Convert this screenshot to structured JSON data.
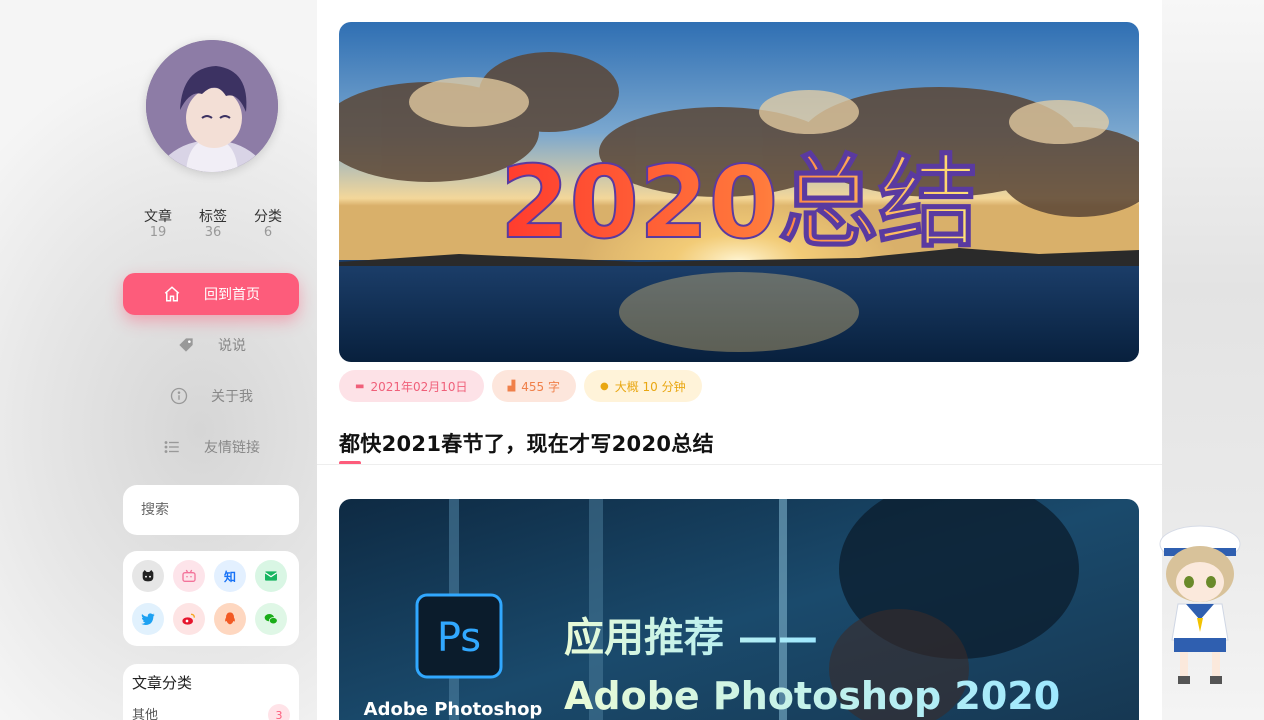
{
  "profile": {
    "stats": [
      {
        "label": "文章",
        "value": "19"
      },
      {
        "label": "标签",
        "value": "36"
      },
      {
        "label": "分类",
        "value": "6"
      }
    ]
  },
  "nav": [
    {
      "label": "回到首页",
      "icon": "home-icon",
      "active": true
    },
    {
      "label": "说说",
      "icon": "tag-icon",
      "active": false
    },
    {
      "label": "关于我",
      "icon": "info-icon",
      "active": false
    },
    {
      "label": "友情链接",
      "icon": "list-icon",
      "active": false
    }
  ],
  "search": {
    "placeholder": "搜索"
  },
  "social": [
    {
      "name": "github-icon",
      "glyph": "",
      "bg": "#e6e6e6",
      "color": "#222"
    },
    {
      "name": "bilibili-icon",
      "glyph": "",
      "bg": "#fde4ea",
      "color": "#f3739a"
    },
    {
      "name": "zhihu-icon",
      "glyph": "知",
      "bg": "#e3f0ff",
      "color": "#1772f6"
    },
    {
      "name": "email-icon",
      "glyph": "",
      "bg": "#d9f6e4",
      "color": "#17b561"
    },
    {
      "name": "twitter-icon",
      "glyph": "",
      "bg": "#e1f1fd",
      "color": "#1da1f2"
    },
    {
      "name": "weibo-icon",
      "glyph": "",
      "bg": "#fde4e4",
      "color": "#e6162d"
    },
    {
      "name": "qq-icon",
      "glyph": "",
      "bg": "#fed7c0",
      "color": "#f25a24"
    },
    {
      "name": "wechat-icon",
      "glyph": "",
      "bg": "#dff7e6",
      "color": "#1aad19"
    }
  ],
  "categories": {
    "title": "文章分类",
    "items": [
      {
        "label": "其他",
        "count": "3"
      }
    ]
  },
  "posts": [
    {
      "cover_text": "2020总结",
      "date": "2021年02月10日",
      "words": "455 字",
      "read_time": "大概 10 分钟",
      "title": "都快2021春节了，现在才写2020总结"
    },
    {
      "cover_logo": "Ps",
      "cover_brand": "Adobe Photoshop",
      "cover_line1": "应用推荐 ——",
      "cover_line2": "Adobe Photoshop 2020"
    }
  ],
  "colors": {
    "accent": "#fd5c7b"
  }
}
